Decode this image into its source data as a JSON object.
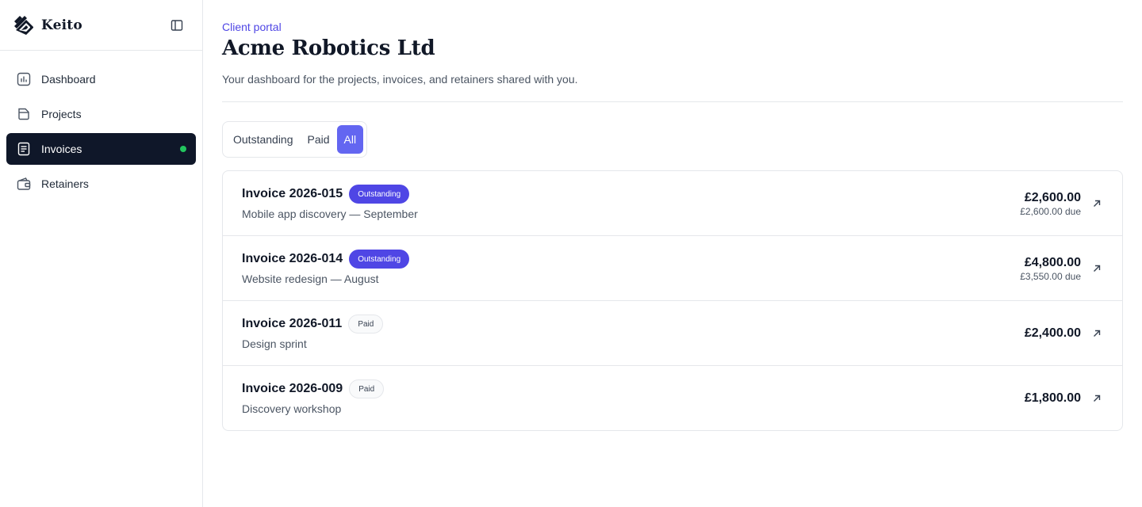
{
  "brand": {
    "name": "Keito"
  },
  "nav": {
    "items": [
      {
        "label": "Dashboard",
        "icon": "chart-bar-icon",
        "active": false
      },
      {
        "label": "Projects",
        "icon": "folder-icon",
        "active": false
      },
      {
        "label": "Invoices",
        "icon": "document-text-icon",
        "active": true
      },
      {
        "label": "Retainers",
        "icon": "wallet-icon",
        "active": false
      }
    ]
  },
  "header": {
    "eyebrow": "Client portal",
    "title": "Acme Robotics Ltd",
    "subtitle": "Your dashboard for the projects, invoices, and retainers shared with you."
  },
  "tabs": [
    {
      "label": "Outstanding",
      "active": false
    },
    {
      "label": "Paid",
      "active": false
    },
    {
      "label": "All",
      "active": true
    }
  ],
  "invoices": [
    {
      "number": "Invoice 2026-015",
      "status": "Outstanding",
      "description": "Mobile app discovery — September",
      "amount": "£2,600.00",
      "due": "£2,600.00 due"
    },
    {
      "number": "Invoice 2026-014",
      "status": "Outstanding",
      "description": "Website redesign — August",
      "amount": "£4,800.00",
      "due": "£3,550.00 due"
    },
    {
      "number": "Invoice 2026-011",
      "status": "Paid",
      "description": "Design sprint",
      "amount": "£2,400.00",
      "due": ""
    },
    {
      "number": "Invoice 2026-009",
      "status": "Paid",
      "description": "Discovery workshop",
      "amount": "£1,800.00",
      "due": ""
    }
  ],
  "colors": {
    "accent": "#6366f1",
    "badge_outstanding": "#4f46e5",
    "active_nav": "#0f1729",
    "status_dot": "#22c55e"
  }
}
